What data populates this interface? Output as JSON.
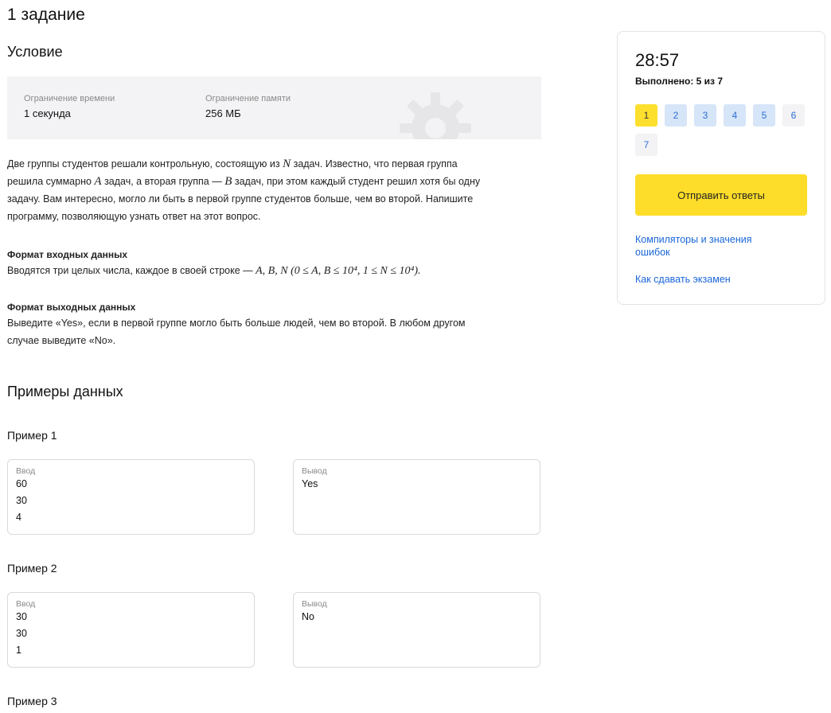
{
  "task_title": "1 задание",
  "condition_title": "Условие",
  "limits": {
    "time_label": "Ограничение времени",
    "time_value": "1 секунда",
    "memory_label": "Ограничение памяти",
    "memory_value": "256 МБ"
  },
  "statement": {
    "l1a": "Две группы студентов решали контрольную, состоящую из ",
    "m_N": "N",
    "l1b": " задач. Известно, что первая группа",
    "l2a": "решила суммарно ",
    "m_A": "A",
    "l2b": " задач, а вторая группа — ",
    "m_B": "B",
    "l2c": " задач, при этом каждый студент решил хотя бы одну",
    "l3": "задачу. Вам интересно, могло ли быть в первой группе студентов больше, чем во второй. Напишите",
    "l4": "программу, позволяющую узнать ответ на этот вопрос."
  },
  "input_format": {
    "heading": "Формат входных данных",
    "text": "Вводятся три целых числа, каждое в своей строке — ",
    "math": "A, B, N (0 ≤ A, B ≤ 10⁴, 1 ≤ N ≤ 10⁴)."
  },
  "output_format": {
    "heading": "Формат выходных данных",
    "line1": "Выведите «Yes», если в первой группе могло быть больше людей, чем во второй. В любом другом",
    "line2": "случае выведите «No»."
  },
  "examples_title": "Примеры данных",
  "examples": [
    {
      "title": "Пример 1",
      "input_label": "Ввод",
      "input": [
        "60",
        "30",
        "4"
      ],
      "output_label": "Вывод",
      "output": [
        "Yes"
      ]
    },
    {
      "title": "Пример 2",
      "input_label": "Ввод",
      "input": [
        "30",
        "30",
        "1"
      ],
      "output_label": "Вывод",
      "output": [
        "No"
      ]
    },
    {
      "title": "Пример 3"
    }
  ],
  "panel": {
    "timer": "28:57",
    "progress": "Выполнено: 5 из 7",
    "tasks": [
      "1",
      "2",
      "3",
      "4",
      "5",
      "6",
      "7"
    ],
    "submit_label": "Отправить ответы",
    "link_compilers": "Компиляторы и значения ошибок",
    "link_exam": "Как сдавать экзамен"
  },
  "colors": {
    "accent_yellow": "#fddd2a",
    "link_blue": "#1a66d8",
    "done_task_bg": "#d6e5f8"
  }
}
